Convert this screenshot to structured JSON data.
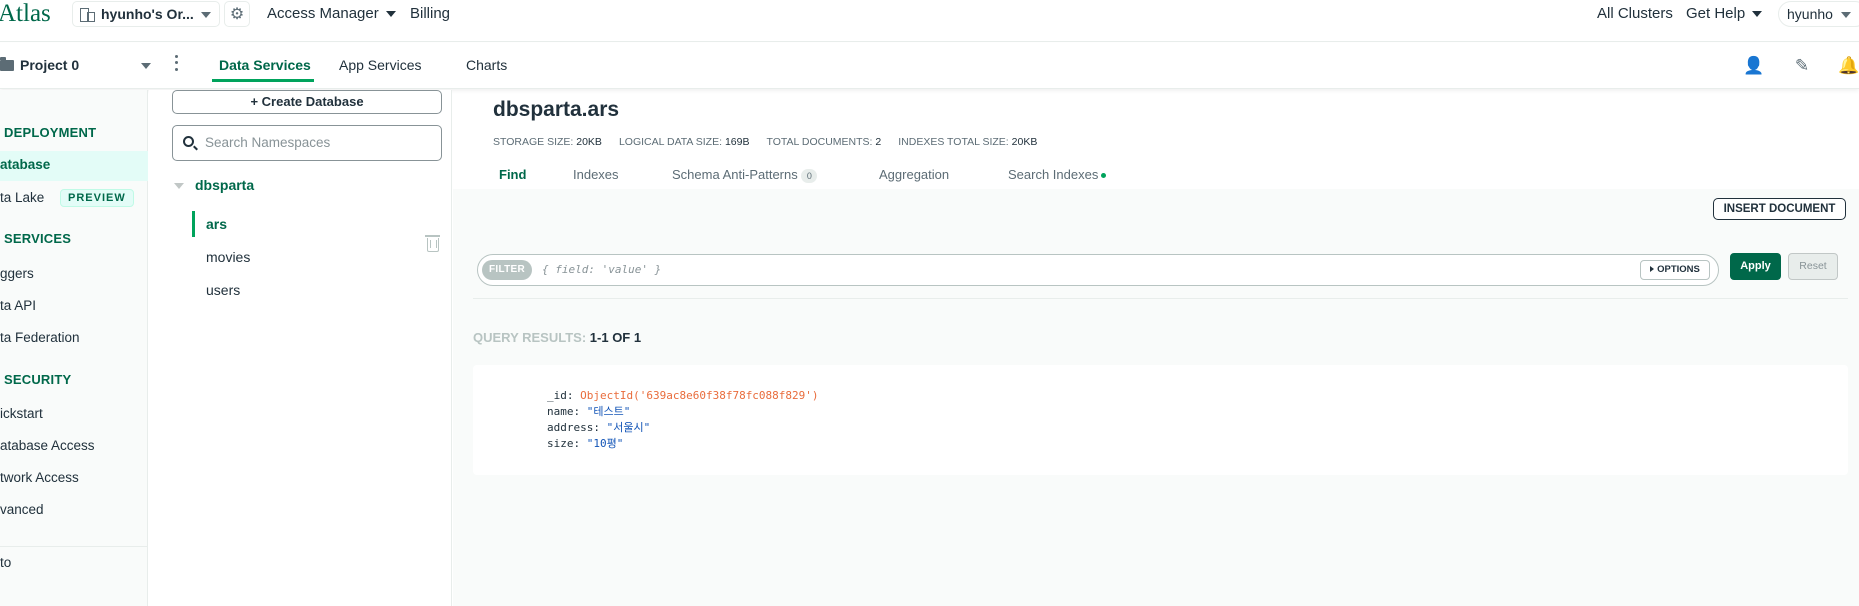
{
  "app": {
    "logo_text": "Atlas"
  },
  "topbar": {
    "org_name": "hyunho's Or...",
    "access_manager": "Access Manager",
    "billing": "Billing",
    "all_clusters": "All Clusters",
    "get_help": "Get Help",
    "user": "hyunho"
  },
  "subbar": {
    "project": "Project 0",
    "tabs": [
      "Data Services",
      "App Services",
      "Charts"
    ],
    "active_tab": "Data Services"
  },
  "leftnav": {
    "deployment_heading": "DEPLOYMENT",
    "database": "atabase",
    "data_lake": "ta Lake",
    "preview_badge": "PREVIEW",
    "services_heading": "SERVICES",
    "triggers": "ggers",
    "data_api": "ta API",
    "data_federation": "ta Federation",
    "security_heading": "SECURITY",
    "quickstart": "ickstart",
    "database_access": "atabase Access",
    "network_access": "twork Access",
    "advanced": "vanced",
    "goto": "to"
  },
  "namespaces": {
    "create_database": "+ Create Database",
    "search_placeholder": "Search Namespaces",
    "database": "dbsparta",
    "collections": [
      "ars",
      "movies",
      "users"
    ],
    "active_collection": "ars"
  },
  "collection": {
    "title": "dbsparta.ars",
    "stats": {
      "storage_label": "STORAGE SIZE:",
      "storage_value": "20KB",
      "logical_label": "LOGICAL DATA SIZE:",
      "logical_value": "169B",
      "docs_label": "TOTAL DOCUMENTS:",
      "docs_value": "2",
      "indexes_label": "INDEXES TOTAL SIZE:",
      "indexes_value": "20KB"
    },
    "tabs": {
      "find": "Find",
      "indexes": "Indexes",
      "schema": "Schema Anti-Patterns",
      "schema_count": "0",
      "aggregation": "Aggregation",
      "search_indexes": "Search Indexes"
    },
    "active_tab": "Find",
    "insert_document": "INSERT DOCUMENT",
    "filter_label": "FILTER",
    "filter_placeholder": "{ field: 'value' }",
    "options": "OPTIONS",
    "apply": "Apply",
    "reset": "Reset",
    "results_label": "QUERY RESULTS:",
    "results_value": "1-1 OF 1",
    "document": {
      "id_key": "_id:",
      "id_value": "ObjectId('639ac8e60f38f78fc088f829')",
      "name_key": "name:",
      "name_value": "\"테스트\"",
      "address_key": "address:",
      "address_value": "\"서울시\"",
      "size_key": "size:",
      "size_value": "\"10평\""
    }
  },
  "colors": {
    "brand_green": "#00684a",
    "accent_green": "#00a35c",
    "objectid_orange": "#e96c3c",
    "string_blue": "#1254b7"
  }
}
